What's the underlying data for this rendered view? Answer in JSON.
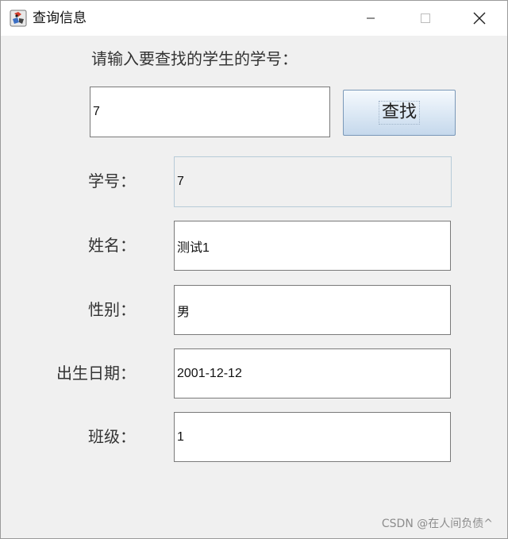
{
  "window": {
    "title": "查询信息",
    "icon": "java-app-icon",
    "controls": [
      "minimize-icon",
      "maximize-icon",
      "close-icon"
    ]
  },
  "search": {
    "prompt": "请输入要查找的学生的学号：",
    "value": "7",
    "button_label": "查找"
  },
  "form": {
    "student_id": {
      "label": "学号：",
      "value": "7",
      "editable": false
    },
    "name": {
      "label": "姓名：",
      "value": "测试1"
    },
    "gender": {
      "label": "性别：",
      "value": "男"
    },
    "birth_date": {
      "label": "出生日期：",
      "value": "2001-12-12"
    },
    "class": {
      "label": "班级：",
      "value": "1"
    }
  },
  "watermark": "CSDN @在人间负债^",
  "colors": {
    "window_background": "#f0f0f0",
    "titlebar_background": "#ffffff",
    "button_gradient_top": "#f5f9fd",
    "button_gradient_bottom": "#c5d8ec",
    "button_border": "#7a98b8",
    "readonly_border": "#b7cbd8"
  }
}
